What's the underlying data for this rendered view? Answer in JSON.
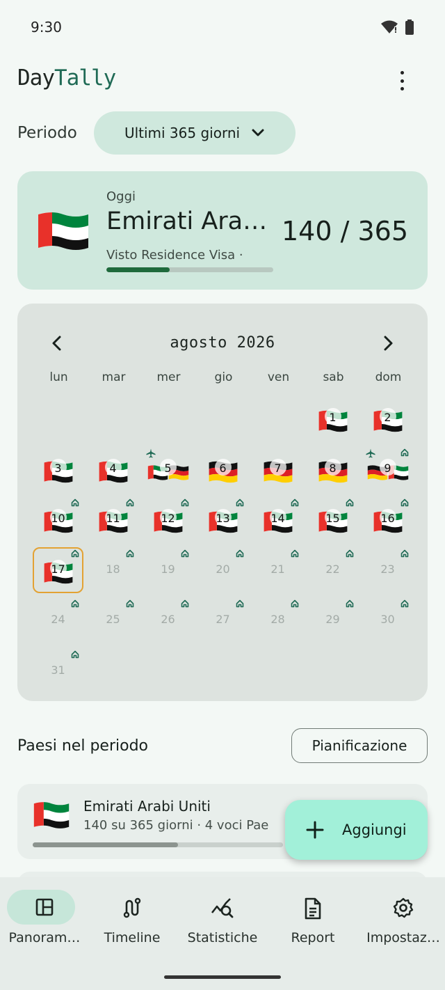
{
  "status": {
    "time": "9:30"
  },
  "app": {
    "title_part1": "Day",
    "title_part2": "Tally"
  },
  "period": {
    "label": "Periodo",
    "selected": "Ultimi 365 giorni"
  },
  "today": {
    "label": "Oggi",
    "country": "Emirati Arab…",
    "visa": "Visto Residence Visa ·",
    "count": "140 / 365",
    "progress": 0.38
  },
  "calendar": {
    "month": "agosto 2026",
    "weekdays": [
      "lun",
      "mar",
      "mer",
      "gio",
      "ven",
      "sab",
      "dom"
    ],
    "days": [
      {
        "n": "1",
        "flags": [
          "ae"
        ],
        "home": false,
        "plane": false
      },
      {
        "n": "2",
        "flags": [
          "ae"
        ],
        "home": false,
        "plane": false
      },
      {
        "n": "3",
        "flags": [
          "ae"
        ],
        "home": false,
        "plane": false
      },
      {
        "n": "4",
        "flags": [
          "ae"
        ],
        "home": false,
        "plane": false
      },
      {
        "n": "5",
        "flags": [
          "ae",
          "de"
        ],
        "home": false,
        "plane": true
      },
      {
        "n": "6",
        "flags": [
          "de"
        ],
        "home": false,
        "plane": false
      },
      {
        "n": "7",
        "flags": [
          "de"
        ],
        "home": false,
        "plane": false
      },
      {
        "n": "8",
        "flags": [
          "de"
        ],
        "home": false,
        "plane": false
      },
      {
        "n": "9",
        "flags": [
          "de",
          "ae"
        ],
        "home": true,
        "plane": true
      },
      {
        "n": "10",
        "flags": [
          "ae"
        ],
        "home": true,
        "plane": false
      },
      {
        "n": "11",
        "flags": [
          "ae"
        ],
        "home": true,
        "plane": false
      },
      {
        "n": "12",
        "flags": [
          "ae"
        ],
        "home": true,
        "plane": false
      },
      {
        "n": "13",
        "flags": [
          "ae"
        ],
        "home": true,
        "plane": false
      },
      {
        "n": "14",
        "flags": [
          "ae"
        ],
        "home": true,
        "plane": false
      },
      {
        "n": "15",
        "flags": [
          "ae"
        ],
        "home": true,
        "plane": false
      },
      {
        "n": "16",
        "flags": [
          "ae"
        ],
        "home": true,
        "plane": false
      },
      {
        "n": "17",
        "flags": [
          "ae"
        ],
        "home": true,
        "plane": false,
        "today": true
      },
      {
        "n": "18",
        "flags": [],
        "home": true,
        "plane": false
      },
      {
        "n": "19",
        "flags": [],
        "home": true,
        "plane": false
      },
      {
        "n": "20",
        "flags": [],
        "home": true,
        "plane": false
      },
      {
        "n": "21",
        "flags": [],
        "home": true,
        "plane": false
      },
      {
        "n": "22",
        "flags": [],
        "home": true,
        "plane": false
      },
      {
        "n": "23",
        "flags": [],
        "home": true,
        "plane": false
      },
      {
        "n": "24",
        "flags": [],
        "home": true,
        "plane": false
      },
      {
        "n": "25",
        "flags": [],
        "home": true,
        "plane": false
      },
      {
        "n": "26",
        "flags": [],
        "home": true,
        "plane": false
      },
      {
        "n": "27",
        "flags": [],
        "home": true,
        "plane": false
      },
      {
        "n": "28",
        "flags": [],
        "home": true,
        "plane": false
      },
      {
        "n": "29",
        "flags": [],
        "home": true,
        "plane": false
      },
      {
        "n": "30",
        "flags": [],
        "home": true,
        "plane": false
      },
      {
        "n": "31",
        "flags": [],
        "home": true,
        "plane": false
      }
    ]
  },
  "countries": {
    "title": "Paesi nel periodo",
    "planning_button": "Pianificazione",
    "items": [
      {
        "name": "Emirati Arabi Uniti",
        "meta": "140 su 365 giorni  ·  4 voci Pae",
        "progress": 0.58
      }
    ]
  },
  "fab": {
    "label": "Aggiungi"
  },
  "nav": {
    "items": [
      {
        "label": "Panoram…",
        "icon": "dashboard-icon",
        "active": true
      },
      {
        "label": "Timeline",
        "icon": "route-icon",
        "active": false
      },
      {
        "label": "Statistiche",
        "icon": "analytics-icon",
        "active": false
      },
      {
        "label": "Report",
        "icon": "document-icon",
        "active": false
      },
      {
        "label": "Impostaz…",
        "icon": "gear-icon",
        "active": false
      }
    ]
  },
  "colors": {
    "accent": "#1f6a55",
    "card": "#cfe8dd",
    "calendar_bg": "#dde3df",
    "fab": "#a2f0d9",
    "today_outline": "#e3a233"
  }
}
